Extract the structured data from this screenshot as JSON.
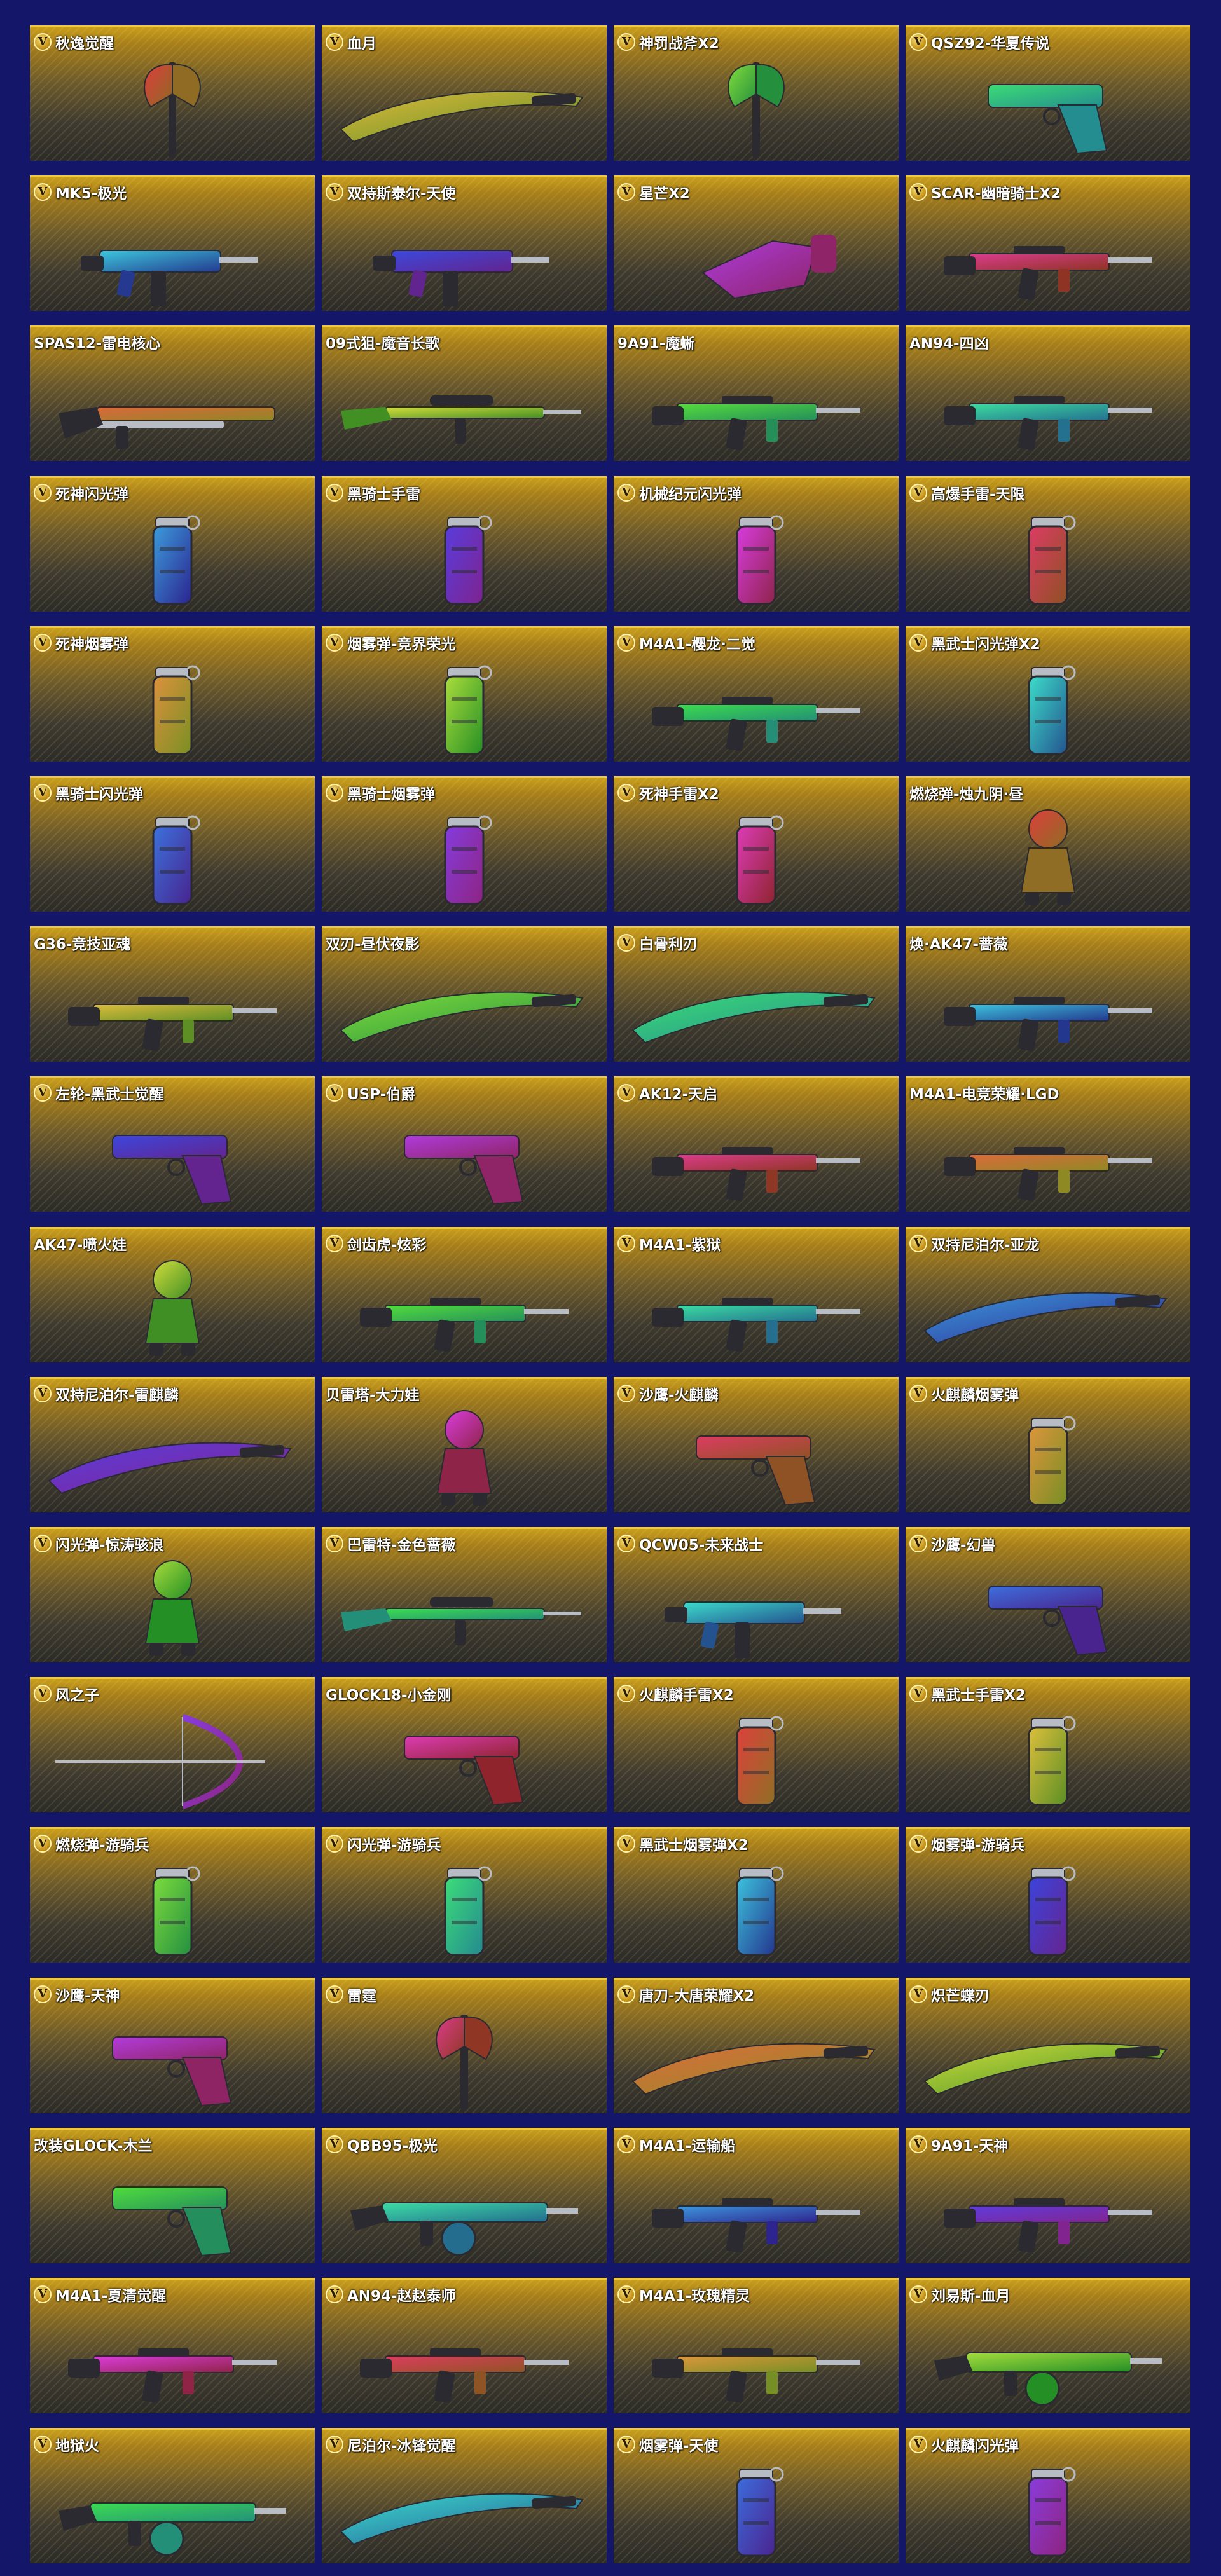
{
  "items": [
    {
      "name": "秋逸觉醒",
      "vip": true,
      "icon": "axe-icon"
    },
    {
      "name": "血月",
      "vip": true,
      "icon": "curved-blade-icon"
    },
    {
      "name": "神罚战斧X2",
      "vip": true,
      "icon": "battle-axe-icon"
    },
    {
      "name": "QSZ92-华夏传说",
      "vip": true,
      "icon": "pistol-icon"
    },
    {
      "name": "MK5-极光",
      "vip": true,
      "icon": "smg-icon"
    },
    {
      "name": "双持斯泰尔-天使",
      "vip": true,
      "icon": "smg-icon"
    },
    {
      "name": "星芒X2",
      "vip": true,
      "icon": "gauntlet-icon"
    },
    {
      "name": "SCAR-幽暗骑士X2",
      "vip": true,
      "icon": "rifle-icon"
    },
    {
      "name": "SPAS12-雷电核心",
      "vip": false,
      "icon": "shotgun-icon"
    },
    {
      "name": "09式狙-魔音长歌",
      "vip": false,
      "icon": "sniper-rifle-icon"
    },
    {
      "name": "9A91-魔蜥",
      "vip": false,
      "icon": "rifle-icon"
    },
    {
      "name": "AN94-四凶",
      "vip": false,
      "icon": "rifle-icon"
    },
    {
      "name": "死神闪光弹",
      "vip": true,
      "icon": "flashbang-icon"
    },
    {
      "name": "黑骑士手雷",
      "vip": true,
      "icon": "grenade-icon"
    },
    {
      "name": "机械纪元闪光弹",
      "vip": true,
      "icon": "flashbang-icon"
    },
    {
      "name": "高爆手雷-天限",
      "vip": true,
      "icon": "grenade-icon"
    },
    {
      "name": "死神烟雾弹",
      "vip": true,
      "icon": "smoke-grenade-icon"
    },
    {
      "name": "烟雾弹-竞界荣光",
      "vip": true,
      "icon": "smoke-grenade-icon"
    },
    {
      "name": "M4A1-樱龙·二觉",
      "vip": true,
      "icon": "rifle-icon"
    },
    {
      "name": "黑武士闪光弹X2",
      "vip": true,
      "icon": "flashbang-icon"
    },
    {
      "name": "黑骑士闪光弹",
      "vip": true,
      "icon": "flashbang-icon"
    },
    {
      "name": "黑骑士烟雾弹",
      "vip": true,
      "icon": "smoke-grenade-icon"
    },
    {
      "name": "死神手雷X2",
      "vip": true,
      "icon": "grenade-icon"
    },
    {
      "name": "燃烧弹-烛九阴·昼",
      "vip": false,
      "icon": "dragon-figure-icon"
    },
    {
      "name": "G36-竞技亚魂",
      "vip": false,
      "icon": "rifle-icon"
    },
    {
      "name": "双刃-昼伏夜影",
      "vip": false,
      "icon": "dual-blades-icon"
    },
    {
      "name": "白骨利刃",
      "vip": true,
      "icon": "bone-blade-icon"
    },
    {
      "name": "焕·AK47-蔷薇",
      "vip": false,
      "icon": "rifle-icon"
    },
    {
      "name": "左轮-黑武士觉醒",
      "vip": true,
      "icon": "revolver-icon"
    },
    {
      "name": "USP-伯爵",
      "vip": true,
      "icon": "pistol-icon"
    },
    {
      "name": "AK12-天启",
      "vip": true,
      "icon": "rifle-icon"
    },
    {
      "name": "M4A1-电竞荣耀·LGD",
      "vip": false,
      "icon": "rifle-icon"
    },
    {
      "name": "AK47-喷火娃",
      "vip": false,
      "icon": "character-figure-icon"
    },
    {
      "name": "剑齿虎-炫彩",
      "vip": true,
      "icon": "rifle-icon"
    },
    {
      "name": "M4A1-紫狱",
      "vip": true,
      "icon": "rifle-icon"
    },
    {
      "name": "双持尼泊尔-亚龙",
      "vip": true,
      "icon": "curved-blade-icon"
    },
    {
      "name": "双持尼泊尔-雷麒麟",
      "vip": true,
      "icon": "curved-blade-icon"
    },
    {
      "name": "贝雷塔-大力娃",
      "vip": false,
      "icon": "character-figure-icon"
    },
    {
      "name": "沙鹰-火麒麟",
      "vip": true,
      "icon": "pistol-icon"
    },
    {
      "name": "火麒麟烟雾弹",
      "vip": true,
      "icon": "smoke-grenade-icon"
    },
    {
      "name": "闪光弹-惊涛骇浪",
      "vip": true,
      "icon": "character-figure-icon"
    },
    {
      "name": "巴雷特-金色蔷薇",
      "vip": true,
      "icon": "sniper-rifle-icon"
    },
    {
      "name": "QCW05-未来战士",
      "vip": true,
      "icon": "smg-icon"
    },
    {
      "name": "沙鹰-幻兽",
      "vip": true,
      "icon": "pistol-icon"
    },
    {
      "name": "风之子",
      "vip": true,
      "icon": "bow-icon"
    },
    {
      "name": "GLOCK18-小金刚",
      "vip": false,
      "icon": "pistol-icon"
    },
    {
      "name": "火麒麟手雷X2",
      "vip": true,
      "icon": "grenade-icon"
    },
    {
      "name": "黑武士手雷X2",
      "vip": true,
      "icon": "grenade-icon"
    },
    {
      "name": "燃烧弹-游骑兵",
      "vip": true,
      "icon": "grenade-icon"
    },
    {
      "name": "闪光弹-游骑兵",
      "vip": true,
      "icon": "flashbang-icon"
    },
    {
      "name": "黑武士烟雾弹X2",
      "vip": true,
      "icon": "smoke-grenade-icon"
    },
    {
      "name": "烟雾弹-游骑兵",
      "vip": true,
      "icon": "smoke-grenade-icon"
    },
    {
      "name": "沙鹰-天神",
      "vip": true,
      "icon": "pistol-icon"
    },
    {
      "name": "雷霆",
      "vip": true,
      "icon": "hammer-icon"
    },
    {
      "name": "唐刀-大唐荣耀X2",
      "vip": true,
      "icon": "sword-icon"
    },
    {
      "name": "炽芒蝶刃",
      "vip": true,
      "icon": "curved-blade-icon"
    },
    {
      "name": "改装GLOCK-木兰",
      "vip": false,
      "icon": "pistol-icon"
    },
    {
      "name": "QBB95-极光",
      "vip": true,
      "icon": "machine-gun-icon"
    },
    {
      "name": "M4A1-运输船",
      "vip": true,
      "icon": "rifle-icon"
    },
    {
      "name": "9A91-天神",
      "vip": true,
      "icon": "rifle-icon"
    },
    {
      "name": "M4A1-夏清觉醒",
      "vip": true,
      "icon": "rifle-icon"
    },
    {
      "name": "AN94-赵赵泰师",
      "vip": true,
      "icon": "rifle-icon"
    },
    {
      "name": "M4A1-玫瑰精灵",
      "vip": true,
      "icon": "rifle-icon"
    },
    {
      "name": "刘易斯-血月",
      "vip": true,
      "icon": "machine-gun-icon"
    },
    {
      "name": "地狱火",
      "vip": true,
      "icon": "machine-gun-icon"
    },
    {
      "name": "尼泊尔-冰锋觉醒",
      "vip": true,
      "icon": "curved-blade-icon"
    },
    {
      "name": "烟雾弹-天使",
      "vip": true,
      "icon": "smoke-grenade-icon"
    },
    {
      "name": "火麒麟闪光弹",
      "vip": true,
      "icon": "flashbang-icon"
    }
  ],
  "vip_badge": "V",
  "colors": {
    "background": "#14166a",
    "card_top": "#c89e1c",
    "card_bottom": "#2c2b27",
    "card_border": "#f0c83a"
  }
}
